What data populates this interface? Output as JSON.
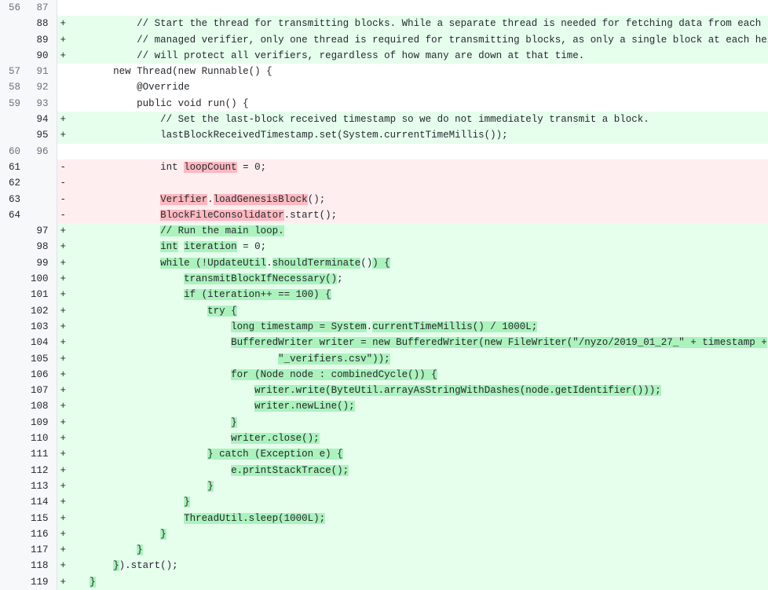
{
  "view": {
    "kind": "github-unified-diff",
    "language": "java",
    "colors": {
      "addition_bg": "#e6ffed",
      "addition_word_bg": "#acf2bd",
      "deletion_bg": "#ffeef0",
      "deletion_word_bg": "#fdb8c0",
      "context_bg": "#ffffff",
      "gutter_bg": "#f6f8fa",
      "gutter_text": "#69737d",
      "code_text": "#24292e",
      "gutter_border": "#e1e4e8"
    }
  },
  "gutter": {
    "old_header": "old-line-number",
    "new_header": "new-line-number"
  },
  "rows": [
    {
      "old": "56",
      "new": "87",
      "type": "ctx",
      "marker": " ",
      "segments": [
        {
          "t": "",
          "h": false
        }
      ]
    },
    {
      "old": "",
      "new": "88",
      "type": "add",
      "marker": "+",
      "segments": [
        {
          "t": "            // Start the thread for transmitting blocks. While a separate thread is needed for fetching data from each",
          "h": false
        }
      ]
    },
    {
      "old": "",
      "new": "89",
      "type": "add",
      "marker": "+",
      "segments": [
        {
          "t": "            // managed verifier, only one thread is required for transmitting blocks, as only a single block at each height",
          "h": false
        }
      ]
    },
    {
      "old": "",
      "new": "90",
      "type": "add",
      "marker": "+",
      "segments": [
        {
          "t": "            // will protect all verifiers, regardless of how many are down at that time.",
          "h": false
        }
      ]
    },
    {
      "old": "57",
      "new": "91",
      "type": "ctx",
      "marker": " ",
      "segments": [
        {
          "t": "        new Thread(new Runnable() {",
          "h": false
        }
      ]
    },
    {
      "old": "58",
      "new": "92",
      "type": "ctx",
      "marker": " ",
      "segments": [
        {
          "t": "            @Override",
          "h": false
        }
      ]
    },
    {
      "old": "59",
      "new": "93",
      "type": "ctx",
      "marker": " ",
      "segments": [
        {
          "t": "            public void run() {",
          "h": false
        }
      ]
    },
    {
      "old": "",
      "new": "94",
      "type": "add",
      "marker": "+",
      "segments": [
        {
          "t": "                // Set the last-block received timestamp so we do not immediately transmit a block.",
          "h": false
        }
      ]
    },
    {
      "old": "",
      "new": "95",
      "type": "add",
      "marker": "+",
      "segments": [
        {
          "t": "                lastBlockReceivedTimestamp.set(System.currentTimeMillis());",
          "h": false
        }
      ]
    },
    {
      "old": "60",
      "new": "96",
      "type": "ctx",
      "marker": " ",
      "segments": [
        {
          "t": "",
          "h": false
        }
      ]
    },
    {
      "old": "61",
      "new": "",
      "type": "del",
      "marker": "-",
      "segments": [
        {
          "t": "                int ",
          "h": false
        },
        {
          "t": "loopCount",
          "h": true
        },
        {
          "t": " = 0;",
          "h": false
        }
      ]
    },
    {
      "old": "62",
      "new": "",
      "type": "del",
      "marker": "-",
      "segments": [
        {
          "t": "",
          "h": false
        }
      ]
    },
    {
      "old": "63",
      "new": "",
      "type": "del",
      "marker": "-",
      "segments": [
        {
          "t": "                ",
          "h": false
        },
        {
          "t": "Verifier",
          "h": true
        },
        {
          "t": ".",
          "h": false
        },
        {
          "t": "loadGenesisBlock",
          "h": true
        },
        {
          "t": "();",
          "h": false
        }
      ]
    },
    {
      "old": "64",
      "new": "",
      "type": "del",
      "marker": "-",
      "segments": [
        {
          "t": "                ",
          "h": false
        },
        {
          "t": "BlockFileConsolidator",
          "h": true
        },
        {
          "t": ".start();",
          "h": false
        }
      ]
    },
    {
      "old": "",
      "new": "97",
      "type": "add",
      "marker": "+",
      "segments": [
        {
          "t": "                ",
          "h": false
        },
        {
          "t": "// Run the main loop.",
          "h": true
        }
      ]
    },
    {
      "old": "",
      "new": "98",
      "type": "add",
      "marker": "+",
      "segments": [
        {
          "t": "                ",
          "h": false
        },
        {
          "t": "int",
          "h": true
        },
        {
          "t": " ",
          "h": false
        },
        {
          "t": "iteration",
          "h": true
        },
        {
          "t": " = 0;",
          "h": false
        }
      ]
    },
    {
      "old": "",
      "new": "99",
      "type": "add",
      "marker": "+",
      "segments": [
        {
          "t": "                ",
          "h": false
        },
        {
          "t": "while (!UpdateUtil",
          "h": true
        },
        {
          "t": ".",
          "h": false
        },
        {
          "t": "shouldTerminate",
          "h": true
        },
        {
          "t": "()",
          "h": false
        },
        {
          "t": ") {",
          "h": true
        }
      ]
    },
    {
      "old": "",
      "new": "100",
      "type": "add",
      "marker": "+",
      "segments": [
        {
          "t": "                    ",
          "h": false
        },
        {
          "t": "transmitBlockIfNecessary()",
          "h": true
        },
        {
          "t": ";",
          "h": false
        }
      ]
    },
    {
      "old": "",
      "new": "101",
      "type": "add",
      "marker": "+",
      "segments": [
        {
          "t": "                    ",
          "h": false
        },
        {
          "t": "if (iteration++ == 100) {",
          "h": true
        }
      ]
    },
    {
      "old": "",
      "new": "102",
      "type": "add",
      "marker": "+",
      "segments": [
        {
          "t": "                        ",
          "h": false
        },
        {
          "t": "try {",
          "h": true
        }
      ]
    },
    {
      "old": "",
      "new": "103",
      "type": "add",
      "marker": "+",
      "segments": [
        {
          "t": "                            ",
          "h": false
        },
        {
          "t": "long timestamp = System",
          "h": true
        },
        {
          "t": ".",
          "h": false
        },
        {
          "t": "currentTimeMillis() / 1000L;",
          "h": true
        }
      ]
    },
    {
      "old": "",
      "new": "104",
      "type": "add",
      "marker": "+",
      "segments": [
        {
          "t": "                            ",
          "h": false
        },
        {
          "t": "BufferedWriter writer = new BufferedWriter(new FileWriter(\"/nyzo/2019_01_27_\" + timestamp +",
          "h": true
        }
      ]
    },
    {
      "old": "",
      "new": "105",
      "type": "add",
      "marker": "+",
      "segments": [
        {
          "t": "                                    ",
          "h": false
        },
        {
          "t": "\"_verifiers.csv\"));",
          "h": true
        }
      ]
    },
    {
      "old": "",
      "new": "106",
      "type": "add",
      "marker": "+",
      "segments": [
        {
          "t": "                            ",
          "h": false
        },
        {
          "t": "for (Node node : combinedCycle()) {",
          "h": true
        }
      ]
    },
    {
      "old": "",
      "new": "107",
      "type": "add",
      "marker": "+",
      "segments": [
        {
          "t": "                                ",
          "h": false
        },
        {
          "t": "writer.write(ByteUtil.arrayAsStringWithDashes(node.getIdentifier()));",
          "h": true
        }
      ]
    },
    {
      "old": "",
      "new": "108",
      "type": "add",
      "marker": "+",
      "segments": [
        {
          "t": "                                ",
          "h": false
        },
        {
          "t": "writer.newLine();",
          "h": true
        }
      ]
    },
    {
      "old": "",
      "new": "109",
      "type": "add",
      "marker": "+",
      "segments": [
        {
          "t": "                            ",
          "h": false
        },
        {
          "t": "}",
          "h": true
        }
      ]
    },
    {
      "old": "",
      "new": "110",
      "type": "add",
      "marker": "+",
      "segments": [
        {
          "t": "                            ",
          "h": false
        },
        {
          "t": "writer.close();",
          "h": true
        }
      ]
    },
    {
      "old": "",
      "new": "111",
      "type": "add",
      "marker": "+",
      "segments": [
        {
          "t": "                        ",
          "h": false
        },
        {
          "t": "} catch (Exception e) {",
          "h": true
        }
      ]
    },
    {
      "old": "",
      "new": "112",
      "type": "add",
      "marker": "+",
      "segments": [
        {
          "t": "                            ",
          "h": false
        },
        {
          "t": "e.printStackTrace();",
          "h": true
        }
      ]
    },
    {
      "old": "",
      "new": "113",
      "type": "add",
      "marker": "+",
      "segments": [
        {
          "t": "                        ",
          "h": false
        },
        {
          "t": "}",
          "h": true
        }
      ]
    },
    {
      "old": "",
      "new": "114",
      "type": "add",
      "marker": "+",
      "segments": [
        {
          "t": "                    ",
          "h": false
        },
        {
          "t": "}",
          "h": true
        }
      ]
    },
    {
      "old": "",
      "new": "115",
      "type": "add",
      "marker": "+",
      "segments": [
        {
          "t": "                    ",
          "h": false
        },
        {
          "t": "ThreadUtil.sleep(1000L);",
          "h": true
        }
      ]
    },
    {
      "old": "",
      "new": "116",
      "type": "add",
      "marker": "+",
      "segments": [
        {
          "t": "                ",
          "h": false
        },
        {
          "t": "}",
          "h": true
        }
      ]
    },
    {
      "old": "",
      "new": "117",
      "type": "add",
      "marker": "+",
      "segments": [
        {
          "t": "            ",
          "h": false
        },
        {
          "t": "}",
          "h": true
        }
      ]
    },
    {
      "old": "",
      "new": "118",
      "type": "add",
      "marker": "+",
      "segments": [
        {
          "t": "        ",
          "h": false
        },
        {
          "t": "}",
          "h": true
        },
        {
          "t": ").start();",
          "h": false
        }
      ]
    },
    {
      "old": "",
      "new": "119",
      "type": "add",
      "marker": "+",
      "segments": [
        {
          "t": "    ",
          "h": false
        },
        {
          "t": "}",
          "h": true
        }
      ]
    }
  ]
}
